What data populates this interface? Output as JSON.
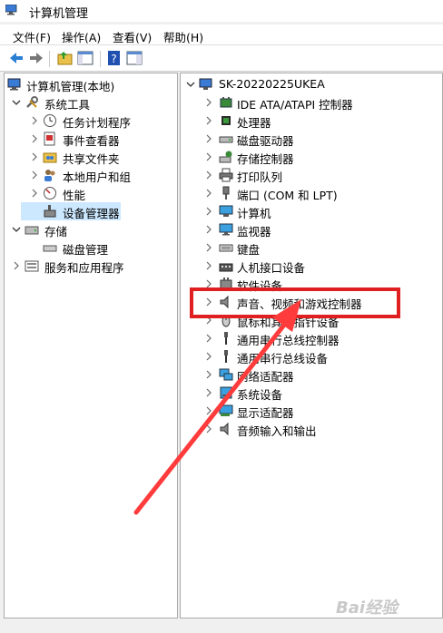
{
  "window": {
    "title": "计算机管理"
  },
  "menu": [
    "文件(F)",
    "操作(A)",
    "查看(V)",
    "帮助(H)"
  ],
  "left_tree": {
    "root": "计算机管理(本地)",
    "system_tools": "系统工具",
    "system_children": [
      "任务计划程序",
      "事件查看器",
      "共享文件夹",
      "本地用户和组",
      "性能",
      "设备管理器"
    ],
    "storage": "存储",
    "storage_children": [
      "磁盘管理"
    ],
    "services": "服务和应用程序"
  },
  "device_tree": {
    "computer": "SK-20220225UKEA",
    "categories": [
      "IDE ATA/ATAPI 控制器",
      "处理器",
      "磁盘驱动器",
      "存储控制器",
      "打印队列",
      "端口 (COM 和 LPT)",
      "计算机",
      "监视器",
      "键盘",
      "人机接口设备",
      "软件设备",
      "声音、视频和游戏控制器",
      "鼠标和其他指针设备",
      "通用串行总线控制器",
      "通用串行总线设备",
      "网络适配器",
      "系统设备",
      "显示适配器",
      "音频输入和输出"
    ]
  },
  "watermark": "Bai经验"
}
